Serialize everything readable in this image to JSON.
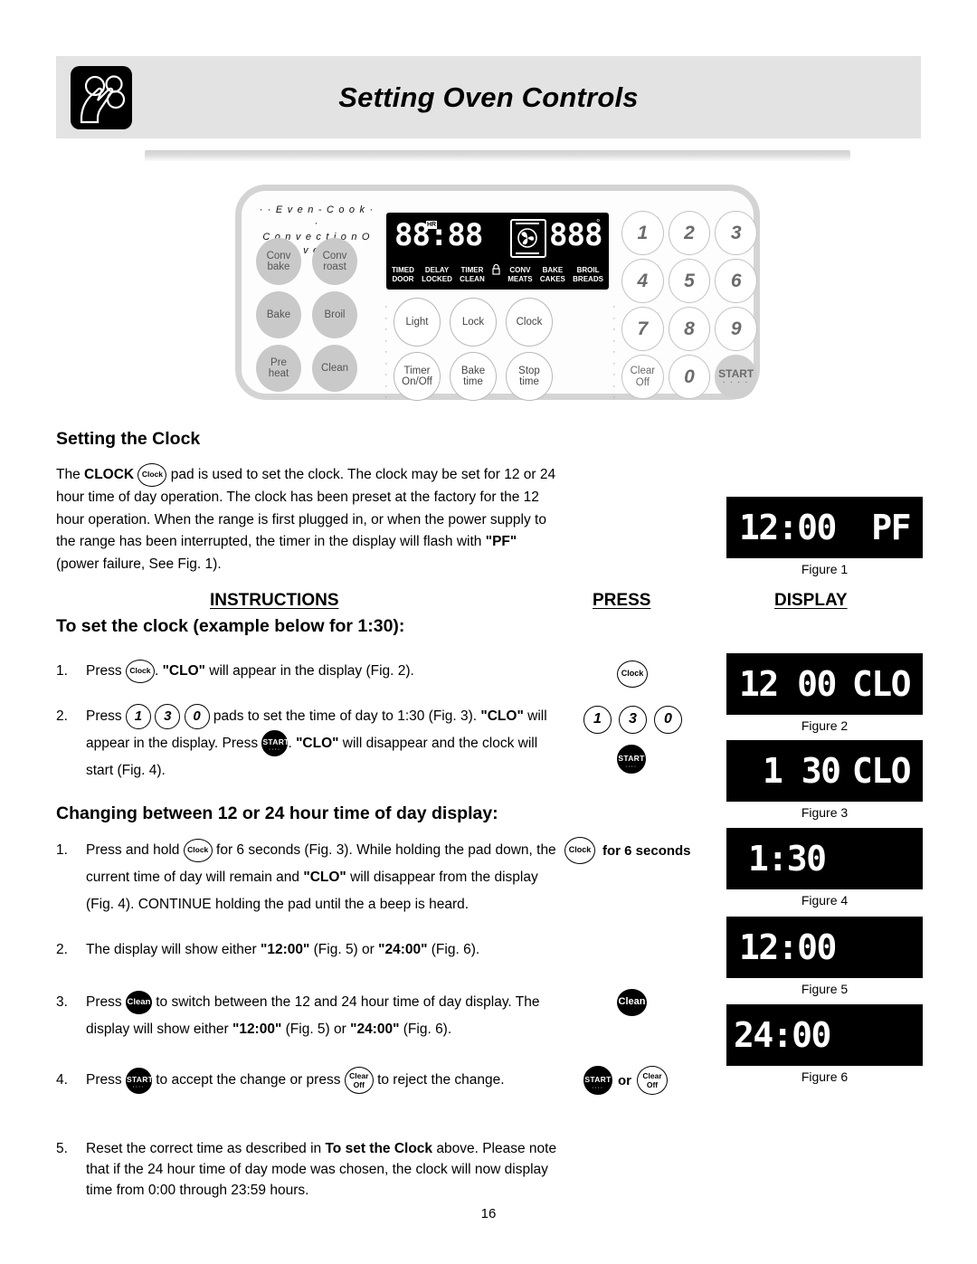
{
  "header": {
    "title": "Setting Oven Controls",
    "icon": "hands-pressing-controls-icon"
  },
  "control_panel": {
    "brand_line1": "· · E v e n - C o o k · ·",
    "brand_line2": "C o n v e c t i o n   O v e n",
    "left_pads": [
      "Conv\nbake",
      "Conv\nroast",
      "Bake",
      "Broil",
      "Pre\nheat",
      "Clean"
    ],
    "lcd": {
      "digits": "88:88",
      "hr_flag": "HR",
      "temp": "888",
      "degree": "°",
      "fan_icon": "convection-fan-icon",
      "indicators": [
        "TIMED\nDOOR",
        "DELAY\nLOCKED",
        "TIMER\nCLEAN",
        "lock-icon",
        "CONV\nMEATS",
        "BAKE\nCAKES",
        "BROIL\nBREADS"
      ]
    },
    "center_pads": [
      "Light",
      "Lock",
      "Clock",
      "Timer\nOn/Off",
      "Bake\ntime",
      "Stop\ntime"
    ],
    "keypad": [
      "1",
      "2",
      "3",
      "4",
      "5",
      "6",
      "7",
      "8",
      "9",
      "Clear\nOff",
      "0",
      "START"
    ],
    "start_dots": "· · · ·"
  },
  "section": {
    "title": "Setting the Clock",
    "intro_a": "The ",
    "intro_clock_bold": "CLOCK",
    "intro_b": " pad is used to set the clock. The clock may be",
    "intro_c": "set for 12 or 24 hour time of day operation.  The clock has been preset at the factory for the 12 hour operation.  When the range is first plugged in, or when the power supply to the range has been interrupted, the timer in the display will flash with ",
    "intro_pf": "\"PF\"",
    "intro_d": " (power failure, See Fig. 1)."
  },
  "columns": {
    "instructions": "INSTRUCTIONS",
    "press": "PRESS",
    "display": "DISPLAY"
  },
  "set_clock": {
    "heading": "To set the clock (example below for 1:30):",
    "steps": [
      {
        "num": "1.",
        "a": "Press ",
        "b": ". ",
        "bold1": "\"CLO\"",
        "c": " will appear in the display (Fig. 2)."
      },
      {
        "num": "2.",
        "a": "Press ",
        "b": " pads to set the time of day to 1:30 (Fig. 3). ",
        "bold1": "\"CLO\"",
        "c": " will appear in the display.  Press ",
        "d": ". ",
        "bold2": "\"CLO\"",
        "e": " will disappear and the clock will start (Fig. 4)."
      }
    ]
  },
  "change_mode": {
    "heading": "Changing between 12 or 24 hour time of day display:",
    "steps": [
      {
        "num": "1.",
        "a": "Press and hold ",
        "b": " for 6 seconds (Fig. 3). While holding the pad down, the current time of day will remain and ",
        "bold1": "\"CLO\"",
        "c": " will disappear from the display (Fig. 4). CONTINUE holding the pad until the a beep is heard."
      },
      {
        "num": "2.",
        "a": "The display will show either ",
        "bold1": "\"12:00\"",
        "b": " (Fig. 5) or ",
        "bold2": "\"24:00\"",
        "c": " (Fig. 6)."
      },
      {
        "num": "3.",
        "a": "Press ",
        "b": " to switch between the 12 and 24 hour time of day display. The display will show either ",
        "bold1": "\"12:00\"",
        "c": " (Fig. 5) or ",
        "bold2": "\"24:00\"",
        "d": " (Fig. 6)."
      },
      {
        "num": "4.",
        "a": "Press ",
        "b": " to accept the change or press ",
        "c": " to reject the change."
      },
      {
        "num": "5.",
        "a": "Reset the correct time as described in ",
        "bold1": "To set the Clock",
        "b": " above. Please note that if the 24 hour time of day mode was chosen, the clock will now display time from 0:00 through 23:59 hours."
      }
    ]
  },
  "press_column": {
    "step1_pad": "Clock",
    "step2_pads": [
      "1",
      "3",
      "0"
    ],
    "step2_start": "START",
    "hold_pad": "Clock",
    "hold_label": "for 6 seconds",
    "clean_pad": "Clean",
    "start_pad": "START",
    "or_label": "or",
    "clear_pad": "Clear\nOff"
  },
  "figures": [
    {
      "caption": "Figure 1",
      "left": "12:00",
      "right": "PF"
    },
    {
      "caption": "Figure 2",
      "left": "12 00",
      "right": "CLO"
    },
    {
      "caption": "Figure 3",
      "left": "1 30",
      "right": "CLO"
    },
    {
      "caption": "Figure 4",
      "left": "1:30",
      "right": ""
    },
    {
      "caption": "Figure 5",
      "left": "12:00",
      "right": ""
    },
    {
      "caption": "Figure 6",
      "left": "24:00",
      "right": ""
    }
  ],
  "page_number": "16",
  "colors": {
    "header_bg": "#e3e3e3",
    "lcd_bg": "#000000",
    "pad_gray": "#c9c9c9"
  }
}
